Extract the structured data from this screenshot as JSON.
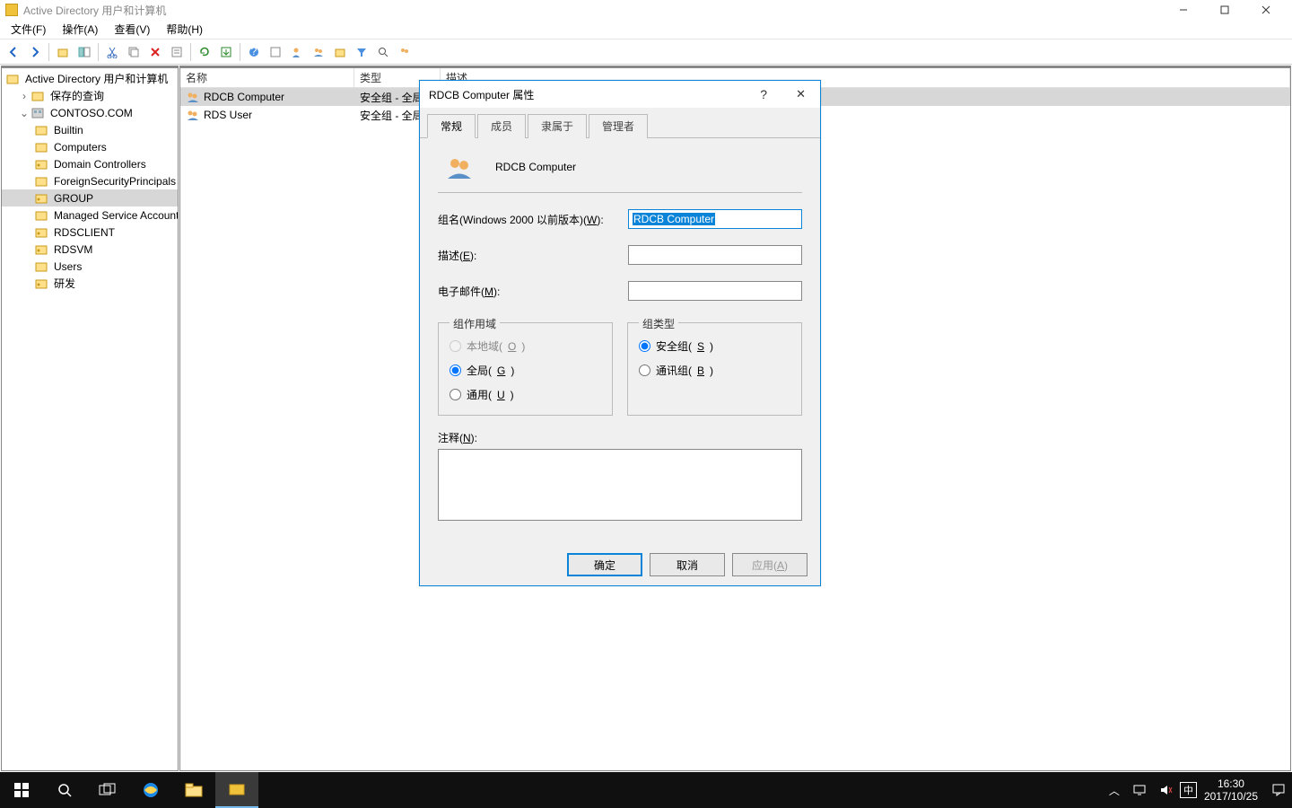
{
  "window": {
    "title": "Active Directory 用户和计算机"
  },
  "menubar": [
    "文件(F)",
    "操作(A)",
    "查看(V)",
    "帮助(H)"
  ],
  "tree": {
    "root": "Active Directory 用户和计算机",
    "saved": "保存的查询",
    "domain": "CONTOSO.COM",
    "nodes": [
      "Builtin",
      "Computers",
      "Domain Controllers",
      "ForeignSecurityPrincipals",
      "GROUP",
      "Managed Service Accounts",
      "RDSCLIENT",
      "RDSVM",
      "Users",
      "研发"
    ]
  },
  "list": {
    "cols": [
      "名称",
      "类型",
      "描述"
    ],
    "rows": [
      {
        "name": "RDCB Computer",
        "type": "安全组 - 全局",
        "sel": true
      },
      {
        "name": "RDS User",
        "type": "安全组 - 全局",
        "sel": false
      }
    ]
  },
  "dialog": {
    "title": "RDCB Computer 属性",
    "tabs": [
      "常规",
      "成员",
      "隶属于",
      "管理者"
    ],
    "header_name": "RDCB Computer",
    "group_name_label": "组名(Windows 2000 以前版本)(W):",
    "group_name_value": "RDCB Computer",
    "desc_label": "描述(E):",
    "email_label": "电子邮件(M):",
    "scope_legend": "组作用域",
    "scope_opts": [
      {
        "label": "本地域(O)",
        "disabled": true,
        "checked": false
      },
      {
        "label": "全局(G)",
        "disabled": false,
        "checked": true
      },
      {
        "label": "通用(U)",
        "disabled": false,
        "checked": false
      }
    ],
    "type_legend": "组类型",
    "type_opts": [
      {
        "label": "安全组(S)",
        "checked": true
      },
      {
        "label": "通讯组(B)",
        "checked": false
      }
    ],
    "notes_label": "注释(N):",
    "buttons": {
      "ok": "确定",
      "cancel": "取消",
      "apply": "应用(A)"
    }
  },
  "taskbar": {
    "time": "16:30",
    "date": "2017/10/25",
    "ime": "中"
  }
}
